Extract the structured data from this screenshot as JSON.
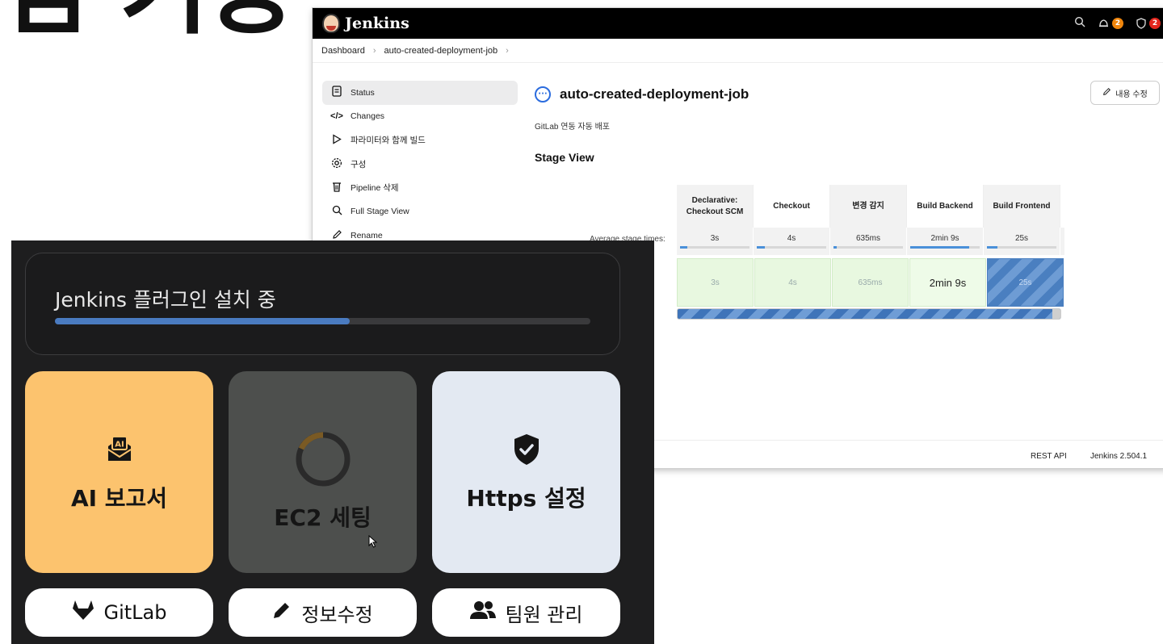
{
  "heading": {
    "text": "점 기능"
  },
  "jenkins": {
    "logo_text": "Jenkins",
    "notif_count": "2",
    "security_count": "2",
    "breadcrumb": [
      "Dashboard",
      "auto-created-deployment-job"
    ],
    "sidebar": [
      {
        "icon": "status-icon",
        "label": "Status",
        "active": true
      },
      {
        "icon": "code-icon",
        "label": "Changes"
      },
      {
        "icon": "play-icon",
        "label": "파라미터와 함께 빌드"
      },
      {
        "icon": "gear-icon",
        "label": "구성"
      },
      {
        "icon": "trash-icon",
        "label": "Pipeline 삭제"
      },
      {
        "icon": "search-icon",
        "label": "Full Stage View"
      },
      {
        "icon": "pencil-icon",
        "label": "Rename"
      }
    ],
    "job_title": "auto-created-deployment-job",
    "description": "GitLab 연동 자동 배포",
    "stage_view_title": "Stage View",
    "edit_button": "내용 수정",
    "avg_label": "Average stage times:",
    "stages": [
      {
        "name_line1": "Declarative:",
        "name_line2": "Checkout SCM",
        "avg": "3s",
        "run": "3s",
        "avg_progress": 0.1
      },
      {
        "name_line1": "Checkout",
        "name_line2": "",
        "avg": "4s",
        "run": "4s",
        "avg_progress": 0.12
      },
      {
        "name_line1": "변경 감지",
        "name_line2": "",
        "avg": "635ms",
        "run": "635ms",
        "avg_progress": 0.05
      },
      {
        "name_line1": "Build Backend",
        "name_line2": "",
        "avg": "2min 9s",
        "run": "2min 9s",
        "avg_progress": 0.85
      },
      {
        "name_line1": "Build Frontend",
        "name_line2": "",
        "avg": "25s",
        "run": "25s",
        "avg_progress": 0.15
      }
    ],
    "footer": {
      "rest_api": "REST API",
      "version": "Jenkins 2.504.1"
    }
  },
  "panel": {
    "install_title": "Jenkins 플러그인 설치 중",
    "install_progress": 0.55,
    "tiles": [
      {
        "label": "AI 보고서",
        "icon": "ai-mail-icon",
        "color": "#fcc36e"
      },
      {
        "label": "EC2 세팅",
        "icon": "spinner-icon",
        "color": "#4d4f4d"
      },
      {
        "label": "Https 설정",
        "icon": "shield-check-icon",
        "color": "#e3e9f2"
      }
    ],
    "pills": [
      {
        "label": "GitLab",
        "icon": "gitlab-icon"
      },
      {
        "label": "정보수정",
        "icon": "pencil-icon"
      },
      {
        "label": "팀원 관리",
        "icon": "users-icon"
      }
    ]
  }
}
